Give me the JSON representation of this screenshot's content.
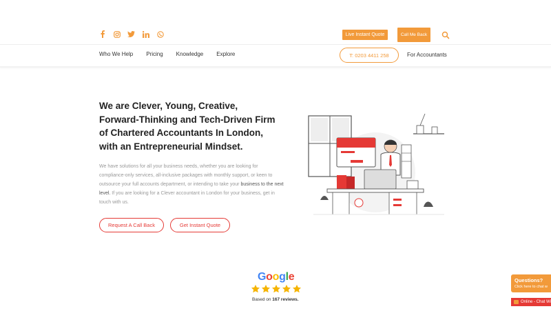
{
  "header": {
    "social_icons": [
      "facebook-icon",
      "instagram-icon",
      "twitter-icon",
      "linkedin-icon",
      "whatsapp-icon"
    ],
    "instant_quote_label": "Live Instant Quote",
    "call_me_back_label": "Call Me Back",
    "search_icon": "search-icon"
  },
  "nav": {
    "items": [
      "Who We Help",
      "Pricing",
      "Knowledge",
      "Explore"
    ],
    "phone_label": "T: 0203 4411 258",
    "for_accountants_label": "For Accountants"
  },
  "hero": {
    "headline": "We are Clever, Young, Creative, Forward-Thinking and Tech-Driven Firm of Chartered Accountants In London, with an Entrepreneurial Mindset.",
    "description_part1": "We have solutions for all your business needs, whether you are looking for compliance-only services, all-inclusive packages with monthly support, or keen to outsource your full accounts department, or intending to take your",
    "description_part2": "business to the next level.",
    "description_part3": " If you are looking for a Clever accountant in London for your business, get in touch with us.",
    "cta_call_back": "Request A Call Back",
    "cta_quote": "Get Instant Quote"
  },
  "reviews": {
    "brand": "Google",
    "rating_stars": 5,
    "prefix": "Based on ",
    "count": "167 reviews.",
    "suffix": ""
  },
  "chat": {
    "title": "Questions?",
    "subtitle": "Click here to chat w",
    "online_label": "Online - Chat Wi"
  },
  "colors": {
    "accent_orange": "#f29a3a",
    "accent_red": "#e53935"
  }
}
